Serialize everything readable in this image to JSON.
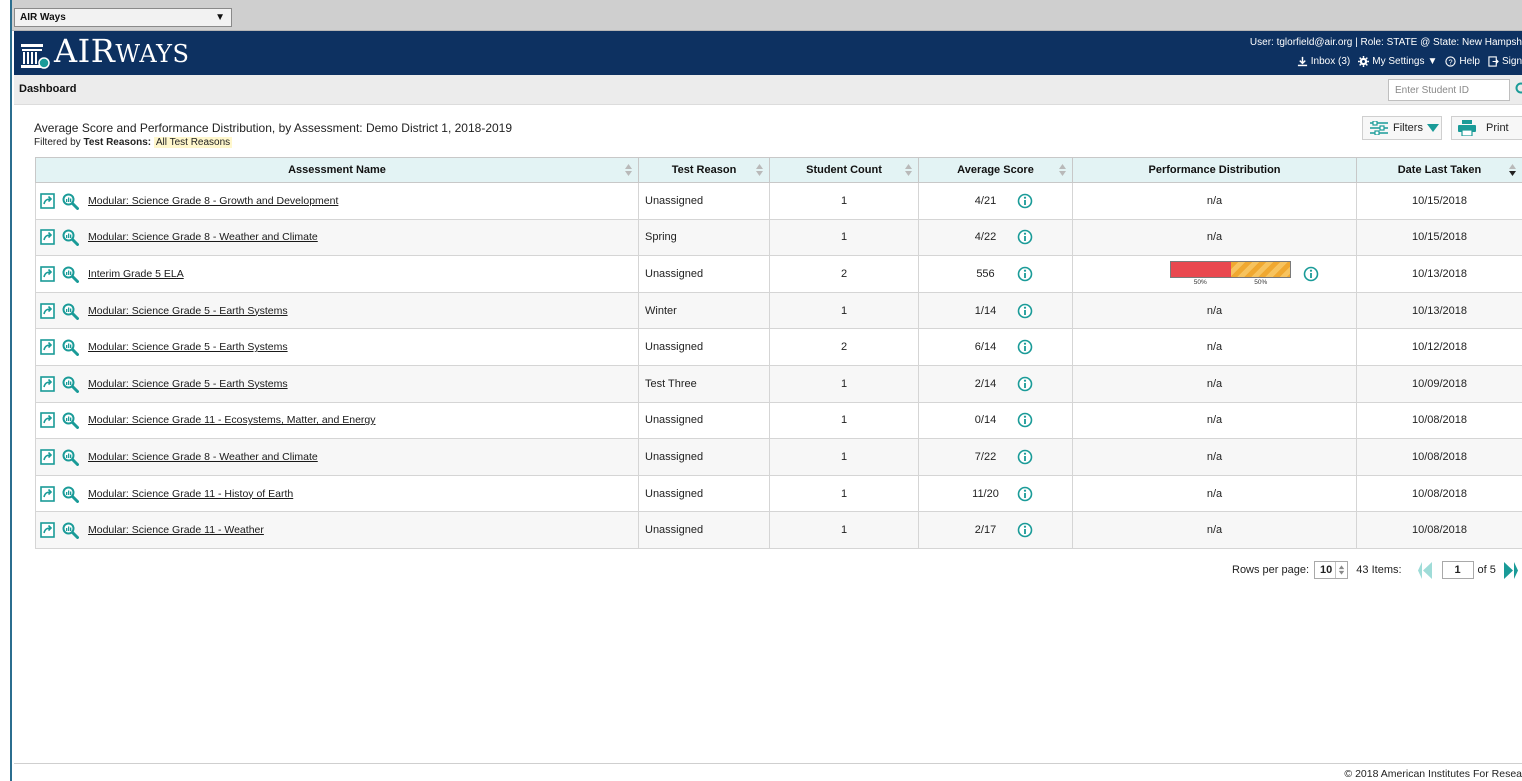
{
  "app_switcher": {
    "label": "AIR Ways"
  },
  "header": {
    "logo_main": "AIR",
    "logo_small": "WAYS",
    "user_line": "User: tglorfield@air.org  |  Role: STATE @ State: New Hampsh",
    "inbox_label": "Inbox (3)",
    "settings_label": "My Settings",
    "help_label": "Help",
    "signout_label": "Sign"
  },
  "dashbar": {
    "title": "Dashboard",
    "student_id_placeholder": "Enter Student ID"
  },
  "report": {
    "title": "Average Score and Performance Distribution, by Assessment: Demo District 1, 2018-2019",
    "filter_prefix": "Filtered by",
    "filter_name": "Test Reasons:",
    "filter_value": "All Test Reasons",
    "filters_button": "Filters",
    "print_button": "Print"
  },
  "table": {
    "columns": [
      "Assessment Name",
      "Test Reason",
      "Student Count",
      "Average Score",
      "Performance Distribution",
      "Date Last Taken"
    ],
    "rows": [
      {
        "name": "Modular: Science Grade 8 - Growth and Development",
        "reason": "Unassigned",
        "count": "1",
        "score": "4/21",
        "perf": "n/a",
        "date": "10/15/2018"
      },
      {
        "name": "Modular: Science Grade 8 - Weather and Climate",
        "reason": "Spring",
        "count": "1",
        "score": "4/22",
        "perf": "n/a",
        "date": "10/15/2018"
      },
      {
        "name": "Interim Grade 5 ELA",
        "reason": "Unassigned",
        "count": "2",
        "score": "556",
        "perf": "bar",
        "perf_segments": [
          {
            "label": "50%",
            "value": 50,
            "color": "#e9484f"
          },
          {
            "label": "50%",
            "value": 50,
            "color": "#f0a830"
          }
        ],
        "date": "10/13/2018"
      },
      {
        "name": "Modular: Science Grade 5 - Earth Systems",
        "reason": "Winter",
        "count": "1",
        "score": "1/14",
        "perf": "n/a",
        "date": "10/13/2018"
      },
      {
        "name": "Modular: Science Grade 5 - Earth Systems",
        "reason": "Unassigned",
        "count": "2",
        "score": "6/14",
        "perf": "n/a",
        "date": "10/12/2018"
      },
      {
        "name": "Modular: Science Grade 5 - Earth Systems",
        "reason": "Test Three",
        "count": "1",
        "score": "2/14",
        "perf": "n/a",
        "date": "10/09/2018"
      },
      {
        "name": "Modular: Science Grade 11 - Ecosystems, Matter, and Energy",
        "reason": "Unassigned",
        "count": "1",
        "score": "0/14",
        "perf": "n/a",
        "date": "10/08/2018"
      },
      {
        "name": "Modular: Science Grade 8 - Weather and Climate",
        "reason": "Unassigned",
        "count": "1",
        "score": "7/22",
        "perf": "n/a",
        "date": "10/08/2018"
      },
      {
        "name": "Modular: Science Grade 11 - Histoy of Earth",
        "reason": "Unassigned",
        "count": "1",
        "score": "11/20",
        "perf": "n/a",
        "date": "10/08/2018"
      },
      {
        "name": "Modular: Science Grade 11 - Weather",
        "reason": "Unassigned",
        "count": "1",
        "score": "2/17",
        "perf": "n/a",
        "date": "10/08/2018"
      }
    ]
  },
  "pager": {
    "rows_label": "Rows per page:",
    "rows_value": "10",
    "items_label": "43 Items:",
    "page_value": "1",
    "of_label": "of 5"
  },
  "footer": {
    "copyright": "© 2018 American Institutes For Resea"
  },
  "colors": {
    "header_bg": "#0d3161",
    "accent_teal": "#1a9b98",
    "table_header_bg": "#e3f3f4"
  },
  "icons": [
    "caret-down-icon",
    "building-logo-icon",
    "download-icon",
    "gear-icon",
    "help-icon",
    "signout-icon",
    "search-icon",
    "filter-sliders-icon",
    "printer-icon",
    "report-export-icon",
    "magnify-chart-icon",
    "info-icon",
    "sort-icon",
    "prev-page-icon",
    "next-page-icon"
  ]
}
